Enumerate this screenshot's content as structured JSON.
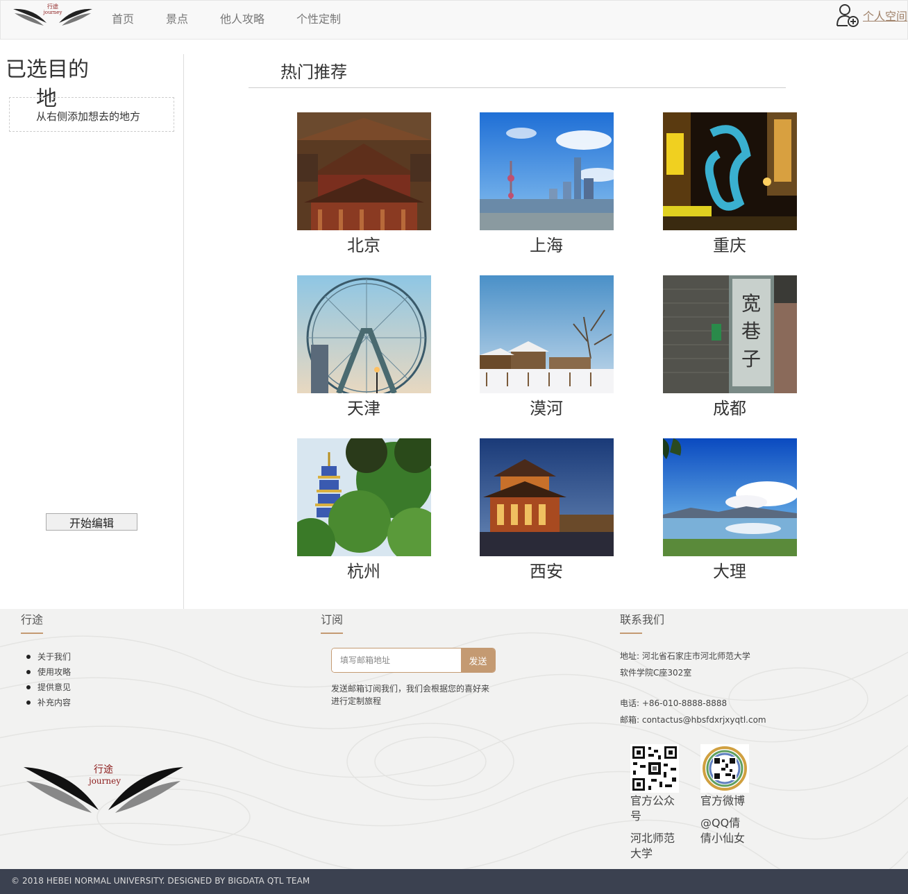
{
  "nav": {
    "brand_cn": "行途",
    "brand_en": "journey",
    "links": [
      "首页",
      "景点",
      "他人攻略",
      "个性定制"
    ],
    "user_link": "个人空间"
  },
  "sidebar": {
    "title_line1": "已选目的",
    "title_line2": "地",
    "hint": "从右侧添加想去的地方",
    "edit_button": "开始编辑"
  },
  "main": {
    "heading": "热门推荐",
    "cities": [
      "北京",
      "上海",
      "重庆",
      "天津",
      "漠河",
      "成都",
      "杭州",
      "西安",
      "大理"
    ]
  },
  "footer": {
    "col1_title": "行途",
    "col1_links": [
      "关于我们",
      "使用攻略",
      "提供意见",
      "补充内容"
    ],
    "col2_title": "订阅",
    "subscribe_placeholder": "填写邮箱地址",
    "subscribe_button": "发送",
    "subscribe_desc": "发送邮箱订阅我们，我们会根据您的喜好来进行定制旅程",
    "col3_title": "联系我们",
    "address_line1": "地址: 河北省石家庄市河北师范大学",
    "address_line2": "软件学院C座302室",
    "phone": "电话: +86-010-8888-8888",
    "email": "邮箱: contactus@hbsfdxrjxyqtl.com",
    "qr1_caption_a": "官方公众号",
    "qr1_caption_b": "河北师范大学",
    "qr2_caption_a": "官方微博",
    "qr2_caption_b": "@QQ倩倩小仙女",
    "logo_cn": "行途",
    "logo_en": "journey",
    "copyright": "© 2018 HEBEI NORMAL UNIVERSITY. DESIGNED BY BIGDATA QTL TEAM"
  },
  "colors": {
    "accent": "#c49a72",
    "copyright_bg": "#3b4150",
    "nav_bg": "#f8f8f8"
  },
  "icons": [
    "logo-wings-icon",
    "user-add-icon",
    "qr-code-icon"
  ]
}
